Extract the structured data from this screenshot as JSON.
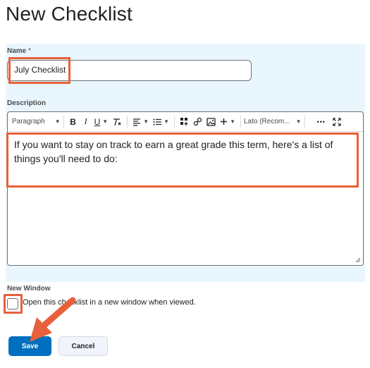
{
  "page": {
    "title": "New Checklist"
  },
  "name_field": {
    "label": "Name",
    "required_mark": "*",
    "value": "July Checklist"
  },
  "description": {
    "label": "Description",
    "text": "If you want to stay on track to earn a great grade this term, here's a list of things you'll need to do:"
  },
  "toolbar": {
    "paragraph": "Paragraph",
    "bold": "B",
    "italic": "I",
    "underline": "U",
    "font": "Lato (Recom...",
    "more": "•••"
  },
  "new_window": {
    "label": "New Window",
    "checked": false,
    "option_text": "Open this checklist in a new window when viewed."
  },
  "buttons": {
    "save": "Save",
    "cancel": "Cancel"
  },
  "annotation_color": "#e8603a",
  "accent_color": "#006fbf"
}
